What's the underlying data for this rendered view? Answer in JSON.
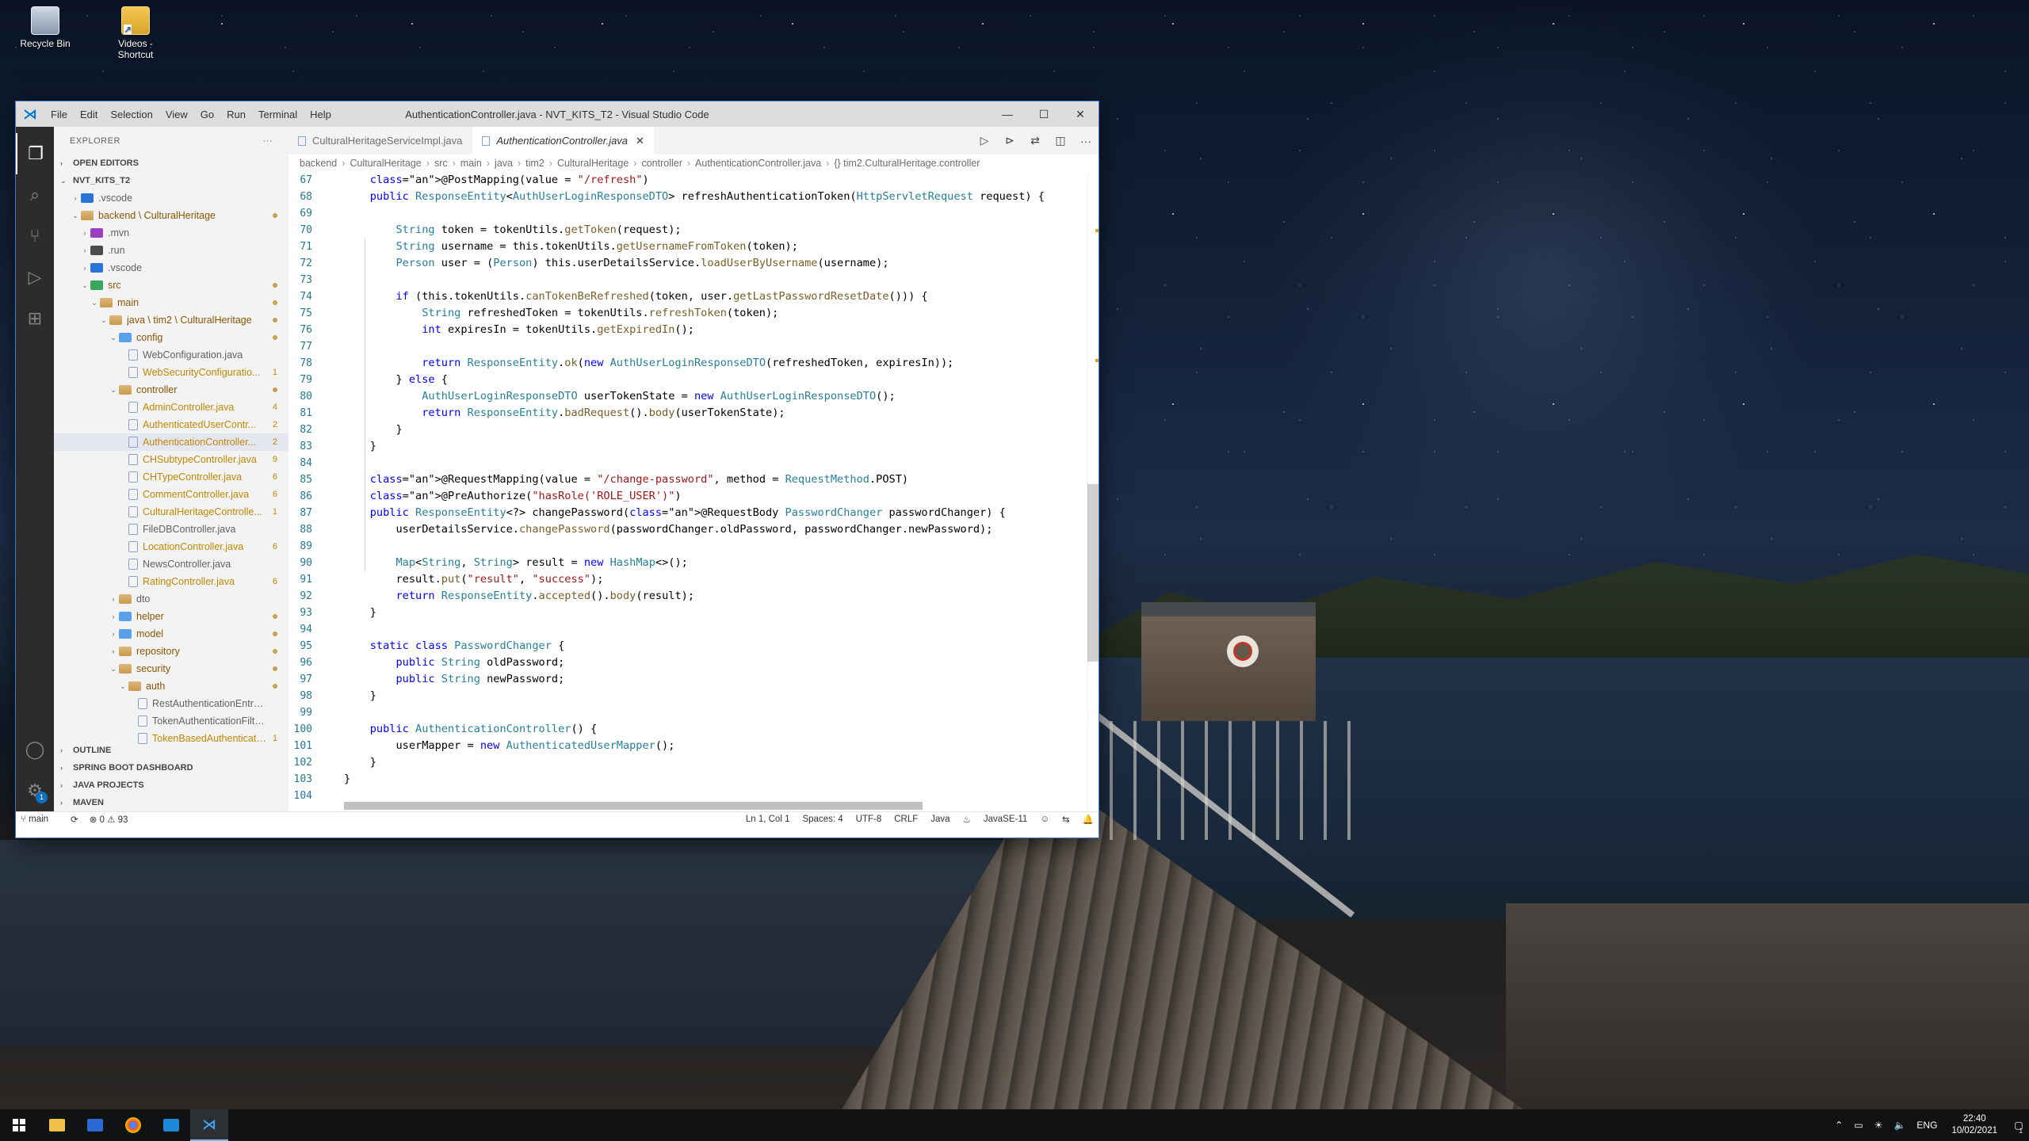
{
  "desktop": {
    "icons": [
      {
        "label": "Recycle Bin"
      },
      {
        "label": "Videos - Shortcut"
      }
    ]
  },
  "window": {
    "menu": [
      "File",
      "Edit",
      "Selection",
      "View",
      "Go",
      "Run",
      "Terminal",
      "Help"
    ],
    "title": "AuthenticationController.java - NVT_KITS_T2 - Visual Studio Code",
    "controls": {
      "minimize": "—",
      "maximize": "☐",
      "close": "✕"
    }
  },
  "sidebar": {
    "header": "EXPLORER",
    "more": "···",
    "open_editors": "OPEN EDITORS",
    "workspace": "NVT_KITS_T2",
    "tree": [
      {
        "label": ".vscode",
        "indent": 1,
        "twist": "›",
        "icon": "fi-vscode",
        "badge": ""
      },
      {
        "label": "backend \\ CulturalHeritage",
        "indent": 1,
        "twist": "⌄",
        "icon": "fi-folder",
        "badge": "dot",
        "cls": "folder-mod"
      },
      {
        "label": ".mvn",
        "indent": 2,
        "twist": "›",
        "icon": "fi-mvn",
        "badge": ""
      },
      {
        "label": ".run",
        "indent": 2,
        "twist": "›",
        "icon": "fi-run",
        "badge": ""
      },
      {
        "label": ".vscode",
        "indent": 2,
        "twist": "›",
        "icon": "fi-vscode",
        "badge": ""
      },
      {
        "label": "src",
        "indent": 2,
        "twist": "⌄",
        "icon": "fi-src",
        "badge": "dot",
        "cls": "folder-mod"
      },
      {
        "label": "main",
        "indent": 3,
        "twist": "⌄",
        "icon": "fi-folder",
        "badge": "dot",
        "cls": "folder-mod"
      },
      {
        "label": "java \\ tim2 \\ CulturalHeritage",
        "indent": 4,
        "twist": "⌄",
        "icon": "fi-folder",
        "badge": "dot",
        "cls": "folder-mod"
      },
      {
        "label": "config",
        "indent": 5,
        "twist": "⌄",
        "icon": "fi-blue",
        "badge": "dot",
        "cls": "folder-mod"
      },
      {
        "label": "WebConfiguration.java",
        "indent": 6,
        "twist": "",
        "icon": "fi-java",
        "badge": ""
      },
      {
        "label": "WebSecurityConfiguratio...",
        "indent": 6,
        "twist": "",
        "icon": "fi-java",
        "badge": "1",
        "cls": "warn"
      },
      {
        "label": "controller",
        "indent": 5,
        "twist": "⌄",
        "icon": "fi-folder",
        "badge": "dot",
        "cls": "folder-mod"
      },
      {
        "label": "AdminController.java",
        "indent": 6,
        "twist": "",
        "icon": "fi-java",
        "badge": "4",
        "cls": "warn"
      },
      {
        "label": "AuthenticatedUserContr...",
        "indent": 6,
        "twist": "",
        "icon": "fi-java",
        "badge": "2",
        "cls": "warn"
      },
      {
        "label": "AuthenticationController...",
        "indent": 6,
        "twist": "",
        "icon": "fi-java",
        "badge": "2",
        "cls": "warn",
        "selected": true
      },
      {
        "label": "CHSubtypeController.java",
        "indent": 6,
        "twist": "",
        "icon": "fi-java",
        "badge": "9",
        "cls": "warn"
      },
      {
        "label": "CHTypeController.java",
        "indent": 6,
        "twist": "",
        "icon": "fi-java",
        "badge": "6",
        "cls": "warn"
      },
      {
        "label": "CommentController.java",
        "indent": 6,
        "twist": "",
        "icon": "fi-java",
        "badge": "6",
        "cls": "warn"
      },
      {
        "label": "CulturalHeritageControlle...",
        "indent": 6,
        "twist": "",
        "icon": "fi-java",
        "badge": "1",
        "cls": "warn"
      },
      {
        "label": "FileDBController.java",
        "indent": 6,
        "twist": "",
        "icon": "fi-java",
        "badge": ""
      },
      {
        "label": "LocationController.java",
        "indent": 6,
        "twist": "",
        "icon": "fi-java",
        "badge": "6",
        "cls": "warn"
      },
      {
        "label": "NewsController.java",
        "indent": 6,
        "twist": "",
        "icon": "fi-java",
        "badge": ""
      },
      {
        "label": "RatingController.java",
        "indent": 6,
        "twist": "",
        "icon": "fi-java",
        "badge": "6",
        "cls": "warn"
      },
      {
        "label": "dto",
        "indent": 5,
        "twist": "›",
        "icon": "fi-folder",
        "badge": ""
      },
      {
        "label": "helper",
        "indent": 5,
        "twist": "›",
        "icon": "fi-blue",
        "badge": "dot",
        "cls": "folder-mod"
      },
      {
        "label": "model",
        "indent": 5,
        "twist": "›",
        "icon": "fi-blue",
        "badge": "dot",
        "cls": "folder-mod"
      },
      {
        "label": "repository",
        "indent": 5,
        "twist": "›",
        "icon": "fi-folder",
        "badge": "dot",
        "cls": "folder-mod"
      },
      {
        "label": "security",
        "indent": 5,
        "twist": "⌄",
        "icon": "fi-folder",
        "badge": "dot",
        "cls": "folder-mod"
      },
      {
        "label": "auth",
        "indent": 6,
        "twist": "⌄",
        "icon": "fi-folder",
        "badge": "dot",
        "cls": "folder-mod"
      },
      {
        "label": "RestAuthenticationEntryPoin...",
        "indent": 7,
        "twist": "",
        "icon": "fi-java",
        "badge": ""
      },
      {
        "label": "TokenAuthenticationFilter.java",
        "indent": 7,
        "twist": "",
        "icon": "fi-java",
        "badge": ""
      },
      {
        "label": "TokenBasedAuthenticati...",
        "indent": 7,
        "twist": "",
        "icon": "fi-java",
        "badge": "1",
        "cls": "warn"
      }
    ],
    "bottom_sections": [
      "OUTLINE",
      "SPRING BOOT DASHBOARD",
      "JAVA PROJECTS",
      "MAVEN"
    ]
  },
  "editor": {
    "tabs": [
      {
        "label": "CulturalHeritageServiceImpl.java",
        "active": false
      },
      {
        "label": "AuthenticationController.java",
        "active": true
      }
    ],
    "tab_close": "✕",
    "breadcrumbs": [
      "backend",
      "CulturalHeritage",
      "src",
      "main",
      "java",
      "tim2",
      "CulturalHeritage",
      "controller",
      "AuthenticationController.java",
      "{} tim2.CulturalHeritage.controller"
    ],
    "lines": [
      {
        "n": "67",
        "t": "    @PostMapping(value = \"/refresh\")"
      },
      {
        "n": "68",
        "t": "    public ResponseEntity<AuthUserLoginResponseDTO> refreshAuthenticationToken(HttpServletRequest request) {"
      },
      {
        "n": "69",
        "t": ""
      },
      {
        "n": "70",
        "t": "        String token = tokenUtils.getToken(request);"
      },
      {
        "n": "71",
        "t": "        String username = this.tokenUtils.getUsernameFromToken(token);"
      },
      {
        "n": "72",
        "t": "        Person user = (Person) this.userDetailsService.loadUserByUsername(username);"
      },
      {
        "n": "73",
        "t": ""
      },
      {
        "n": "74",
        "t": "        if (this.tokenUtils.canTokenBeRefreshed(token, user.getLastPasswordResetDate())) {"
      },
      {
        "n": "75",
        "t": "            String refreshedToken = tokenUtils.refreshToken(token);"
      },
      {
        "n": "76",
        "t": "            int expiresIn = tokenUtils.getExpiredIn();"
      },
      {
        "n": "77",
        "t": ""
      },
      {
        "n": "78",
        "t": "            return ResponseEntity.ok(new AuthUserLoginResponseDTO(refreshedToken, expiresIn));"
      },
      {
        "n": "79",
        "t": "        } else {"
      },
      {
        "n": "80",
        "t": "            AuthUserLoginResponseDTO userTokenState = new AuthUserLoginResponseDTO();"
      },
      {
        "n": "81",
        "t": "            return ResponseEntity.badRequest().body(userTokenState);"
      },
      {
        "n": "82",
        "t": "        }"
      },
      {
        "n": "83",
        "t": "    }"
      },
      {
        "n": "84",
        "t": ""
      },
      {
        "n": "85",
        "t": "    @RequestMapping(value = \"/change-password\", method = RequestMethod.POST)"
      },
      {
        "n": "86",
        "t": "    @PreAuthorize(\"hasRole('ROLE_USER')\")"
      },
      {
        "n": "87",
        "t": "    public ResponseEntity<?> changePassword(@RequestBody PasswordChanger passwordChanger) {"
      },
      {
        "n": "88",
        "t": "        userDetailsService.changePassword(passwordChanger.oldPassword, passwordChanger.newPassword);"
      },
      {
        "n": "89",
        "t": ""
      },
      {
        "n": "90",
        "t": "        Map<String, String> result = new HashMap<>();"
      },
      {
        "n": "91",
        "t": "        result.put(\"result\", \"success\");"
      },
      {
        "n": "92",
        "t": "        return ResponseEntity.accepted().body(result);"
      },
      {
        "n": "93",
        "t": "    }"
      },
      {
        "n": "94",
        "t": ""
      },
      {
        "n": "95",
        "t": "    static class PasswordChanger {"
      },
      {
        "n": "96",
        "t": "        public String oldPassword;"
      },
      {
        "n": "97",
        "t": "        public String newPassword;"
      },
      {
        "n": "98",
        "t": "    }"
      },
      {
        "n": "99",
        "t": ""
      },
      {
        "n": "100",
        "t": "    public AuthenticationController() {"
      },
      {
        "n": "101",
        "t": "        userMapper = new AuthenticatedUserMapper();"
      },
      {
        "n": "102",
        "t": "    }"
      },
      {
        "n": "103",
        "t": "}"
      },
      {
        "n": "104",
        "t": ""
      }
    ]
  },
  "statusbar": {
    "branch": "main",
    "sync": "⟳",
    "problems": "⊗ 0 ⚠ 93",
    "position": "Ln 1, Col 1",
    "spaces": "Spaces: 4",
    "encoding": "UTF-8",
    "eol": "CRLF",
    "language": "Java",
    "java_env": "JavaSE-11"
  },
  "taskbar": {
    "lang": "ENG",
    "time": "22:40",
    "date": "10/02/2021"
  },
  "colors": {
    "accent": "#0078d4",
    "activity_bar": "#2c2c2c",
    "sidebar_bg": "#f3f3f3",
    "modified": "#895503",
    "warning": "#bf8803"
  }
}
